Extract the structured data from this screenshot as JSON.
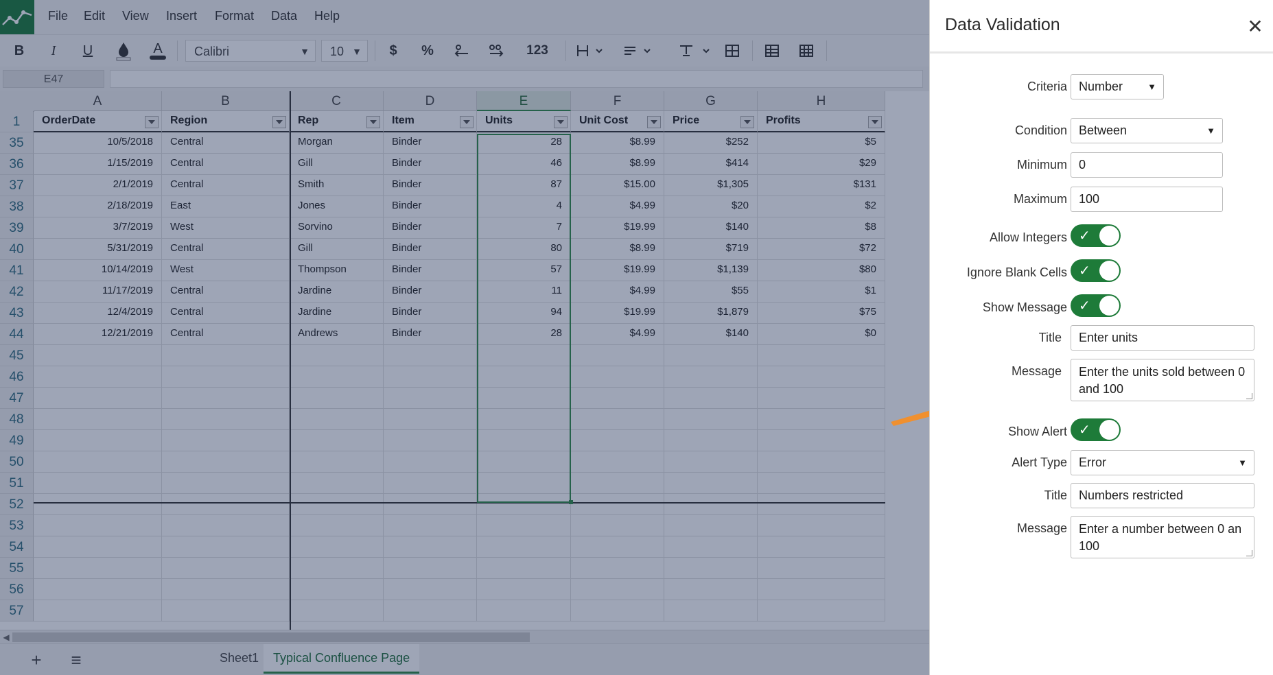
{
  "menu": [
    "File",
    "Edit",
    "View",
    "Insert",
    "Format",
    "Data",
    "Help"
  ],
  "toolbar": {
    "bold": "B",
    "italic": "I",
    "underline": "U",
    "font_color": "A",
    "font_name": "Calibri",
    "font_size": "10",
    "currency": "$",
    "percent": "%",
    "number_format": "123"
  },
  "formula_bar": {
    "cell_ref": "E47",
    "value": ""
  },
  "columns": [
    "A",
    "B",
    "C",
    "D",
    "E",
    "F",
    "G",
    "H"
  ],
  "selected_column": "E",
  "header_row_number": "1",
  "table_headers": [
    "OrderDate",
    "Region",
    "Rep",
    "Item",
    "Units",
    "Unit Cost",
    "Price",
    "Profits"
  ],
  "rows": [
    {
      "n": "35",
      "c": [
        "10/5/2018",
        "Central",
        "Morgan",
        "Binder",
        "28",
        "$8.99",
        "$252",
        "$5"
      ]
    },
    {
      "n": "36",
      "c": [
        "1/15/2019",
        "Central",
        "Gill",
        "Binder",
        "46",
        "$8.99",
        "$414",
        "$29"
      ]
    },
    {
      "n": "37",
      "c": [
        "2/1/2019",
        "Central",
        "Smith",
        "Binder",
        "87",
        "$15.00",
        "$1,305",
        "$131"
      ]
    },
    {
      "n": "38",
      "c": [
        "2/18/2019",
        "East",
        "Jones",
        "Binder",
        "4",
        "$4.99",
        "$20",
        "$2"
      ]
    },
    {
      "n": "39",
      "c": [
        "3/7/2019",
        "West",
        "Sorvino",
        "Binder",
        "7",
        "$19.99",
        "$140",
        "$8"
      ]
    },
    {
      "n": "40",
      "c": [
        "5/31/2019",
        "Central",
        "Gill",
        "Binder",
        "80",
        "$8.99",
        "$719",
        "$72"
      ]
    },
    {
      "n": "41",
      "c": [
        "10/14/2019",
        "West",
        "Thompson",
        "Binder",
        "57",
        "$19.99",
        "$1,139",
        "$80"
      ]
    },
    {
      "n": "42",
      "c": [
        "11/17/2019",
        "Central",
        "Jardine",
        "Binder",
        "11",
        "$4.99",
        "$55",
        "$1"
      ]
    },
    {
      "n": "43",
      "c": [
        "12/4/2019",
        "Central",
        "Jardine",
        "Binder",
        "94",
        "$19.99",
        "$1,879",
        "$75"
      ]
    },
    {
      "n": "44",
      "c": [
        "12/21/2019",
        "Central",
        "Andrews",
        "Binder",
        "28",
        "$4.99",
        "$140",
        "$0"
      ]
    },
    {
      "n": "45",
      "c": [
        "",
        "",
        "",
        "",
        "",
        "",
        "",
        ""
      ]
    },
    {
      "n": "46",
      "c": [
        "",
        "",
        "",
        "",
        "",
        "",
        "",
        ""
      ]
    },
    {
      "n": "47",
      "c": [
        "",
        "",
        "",
        "",
        "",
        "",
        "",
        ""
      ]
    },
    {
      "n": "48",
      "c": [
        "",
        "",
        "",
        "",
        "",
        "",
        "",
        ""
      ]
    },
    {
      "n": "49",
      "c": [
        "",
        "",
        "",
        "",
        "",
        "",
        "",
        ""
      ]
    },
    {
      "n": "50",
      "c": [
        "",
        "",
        "",
        "",
        "",
        "",
        "",
        ""
      ]
    },
    {
      "n": "51",
      "c": [
        "",
        "",
        "",
        "",
        "",
        "",
        "",
        ""
      ]
    },
    {
      "n": "52",
      "c": [
        "",
        "",
        "",
        "",
        "",
        "",
        "",
        ""
      ]
    },
    {
      "n": "53",
      "c": [
        "",
        "",
        "",
        "",
        "",
        "",
        "",
        ""
      ]
    },
    {
      "n": "54",
      "c": [
        "",
        "",
        "",
        "",
        "",
        "",
        "",
        ""
      ]
    },
    {
      "n": "55",
      "c": [
        "",
        "",
        "",
        "",
        "",
        "",
        "",
        ""
      ]
    },
    {
      "n": "56",
      "c": [
        "",
        "",
        "",
        "",
        "",
        "",
        "",
        ""
      ]
    },
    {
      "n": "57",
      "c": [
        "",
        "",
        "",
        "",
        "",
        "",
        "",
        ""
      ]
    }
  ],
  "sheet_tabs": [
    "Sheet1",
    "Typical Confluence Page"
  ],
  "active_sheet": "Typical Confluence Page",
  "panel": {
    "title": "Data Validation",
    "criteria_label": "Criteria",
    "criteria_value": "Number",
    "condition_label": "Condition",
    "condition_value": "Between",
    "minimum_label": "Minimum",
    "minimum_value": "0",
    "maximum_label": "Maximum",
    "maximum_value": "100",
    "allow_integers_label": "Allow Integers",
    "ignore_blank_label": "Ignore Blank Cells",
    "show_message_label": "Show Message",
    "message_title_label": "Title",
    "message_title_value": "Enter units",
    "message_label": "Message",
    "message_value": "Enter the units sold between 0 and 100",
    "show_alert_label": "Show Alert",
    "alert_type_label": "Alert Type",
    "alert_type_value": "Error",
    "alert_title_label": "Title",
    "alert_title_value": "Numbers restricted",
    "alert_message_label": "Message",
    "alert_message_value": "Enter a number between 0 an 100"
  },
  "colors": {
    "accent_green": "#1e7b39",
    "overlay": "#19285a",
    "annotation_arrow": "#f0902f"
  }
}
